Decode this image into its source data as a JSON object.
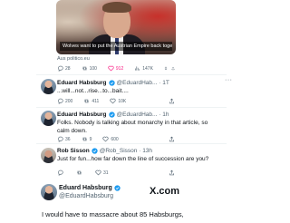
{
  "article": {
    "caption": "Wolves want to put the Austrian Empire back together",
    "source": "Aus politico.eu",
    "stats": {
      "replies": "28",
      "reposts": "100",
      "likes": "912",
      "views": "147K"
    }
  },
  "tweets": [
    {
      "name": "Eduard Habsburg",
      "meta": "@EduardHab... · 1T",
      "text": "...will...not...rise...to...bait....",
      "stats": {
        "replies": "200",
        "reposts": "411",
        "likes": "10K",
        "views": ""
      }
    },
    {
      "name": "Eduard Habsburg",
      "meta": "@EduardHab... · 1h",
      "text": "Folks. Nobody is talking about monarchy in that article, so calm down.",
      "stats": {
        "replies": "36",
        "reposts": "9",
        "likes": "600",
        "views": ""
      }
    },
    {
      "name": "Rob Sisson",
      "meta": "@Rob_Sisson · 13h",
      "text": "Just for fun...how far down the line of succession are you?",
      "stats": {
        "replies": "",
        "reposts": "",
        "likes": "31",
        "views": ""
      }
    }
  ],
  "embed": {
    "name": "Eduard Habsburg",
    "handle": "@EduardHabsburg",
    "brand": "X.com",
    "brand_logo": "𝕏",
    "text": "I would have to massacre about 85 Habsburgs,"
  },
  "more_glyph": "···",
  "colors": {
    "like": "#f91880",
    "verified": "#1d9bf0",
    "muted": "#536471"
  }
}
